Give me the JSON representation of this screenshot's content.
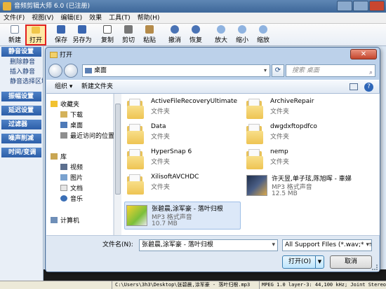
{
  "app": {
    "title": "音频剪辑大师 6.0 (已注册)",
    "menu": [
      "文件(F)",
      "视图(V)",
      "编辑(E)",
      "效果",
      "工具(T)",
      "帮助(H)"
    ],
    "toolbar": [
      {
        "label": "新建",
        "icon": "new-file-icon"
      },
      {
        "label": "打开",
        "icon": "open-folder-icon",
        "highlighted": true
      },
      {
        "label": "保存",
        "icon": "save-icon"
      },
      {
        "label": "另存为",
        "icon": "save-as-icon"
      },
      {
        "label": "复制",
        "icon": "copy-icon"
      },
      {
        "label": "剪切",
        "icon": "cut-icon"
      },
      {
        "label": "粘贴",
        "icon": "paste-icon"
      },
      {
        "label": "撤消",
        "icon": "undo-icon"
      },
      {
        "label": "恢复",
        "icon": "redo-icon"
      },
      {
        "label": "放大",
        "icon": "zoom-in-icon"
      },
      {
        "label": "缩小",
        "icon": "zoom-out-icon"
      },
      {
        "label": "缩放",
        "icon": "zoom-icon"
      }
    ],
    "sidebar": [
      {
        "heading": "静音设置",
        "items": [
          "删除静音",
          "插入静音",
          "静音选择区域"
        ]
      },
      {
        "heading": "振幅设置",
        "items": []
      },
      {
        "heading": "延迟设置",
        "items": []
      },
      {
        "heading": "过滤器",
        "items": []
      },
      {
        "heading": "噪声削减",
        "items": []
      },
      {
        "heading": "时间/变调",
        "items": []
      }
    ],
    "status": {
      "path": "C:\\Users\\3h3\\Desktop\\张碧晨,涂军豪 - 落叶归根.mp3",
      "format": "MPEG 1.0 layer-3: 44,100 kHz; Joint Stereo"
    }
  },
  "dialog": {
    "title": "打开",
    "address": "桌面",
    "search_placeholder": "搜索 桌面",
    "organize": "组织 ▾",
    "new_folder": "新建文件夹",
    "nav": {
      "favorites": "收藏夹",
      "fav_items": [
        "下载",
        "桌面",
        "最近访问的位置"
      ],
      "libraries": "库",
      "lib_items": [
        "视频",
        "图片",
        "文档",
        "音乐"
      ],
      "computer": "计算机"
    },
    "files": [
      {
        "name": "ActiveFileRecoveryUltimate",
        "type": "文件夹",
        "size": "",
        "kind": "folder"
      },
      {
        "name": "ArchiveRepair",
        "type": "文件夹",
        "size": "",
        "kind": "folder"
      },
      {
        "name": "Data",
        "type": "文件夹",
        "size": "",
        "kind": "folder"
      },
      {
        "name": "dwgdxftopdfco",
        "type": "文件夹",
        "size": "",
        "kind": "folder"
      },
      {
        "name": "HyperSnap 6",
        "type": "文件夹",
        "size": "",
        "kind": "folder"
      },
      {
        "name": "nemp",
        "type": "文件夹",
        "size": "",
        "kind": "folder"
      },
      {
        "name": "XilisoftAVCHDC",
        "type": "文件夹",
        "size": "",
        "kind": "folder"
      },
      {
        "name": "许天昱,单子玹,陈旭晖 - 車娣",
        "type": "MP3 格式声音",
        "size": "12.5 MB",
        "kind": "mp3"
      },
      {
        "name": "张碧晨,涂军豪 - 落叶归根",
        "type": "MP3 格式声音",
        "size": "10.7 MB",
        "kind": "mp3-selected"
      }
    ],
    "filename_label": "文件名(N):",
    "filename_value": "张碧晨,涂军豪 - 落叶归根",
    "filetype": "All Support FIles (*.wav;*.mp",
    "open_label": "打开(O)",
    "cancel_label": "取消"
  }
}
